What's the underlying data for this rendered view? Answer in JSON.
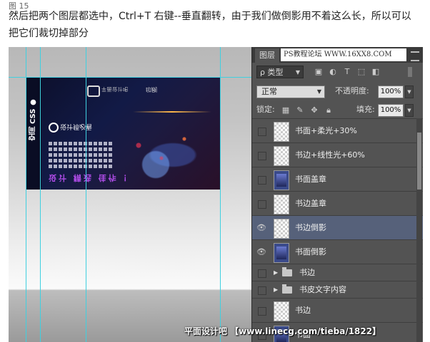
{
  "figure_label": "图 15",
  "caption": {
    "line1": "然后把两个图层都选中，Ctrl+T 右键--垂直翻转，由于我们做倒影用不着这么长，所以可以",
    "line2": "把它们裁切掉部分"
  },
  "book": {
    "spine_text": "空间 CSS ●",
    "brand": "平面设计吧",
    "brand2": "印刷",
    "title": "设计师必看",
    "purple_text": "设计 精选 佳作 ！"
  },
  "panel": {
    "tab_label": "图层",
    "watermark_text": "PS教程论坛 WWW.16XX8.COM",
    "filter": {
      "label": "ρ 类型",
      "icons": [
        "image-filter-icon",
        "adjustment-filter-icon",
        "type-filter-icon",
        "shape-filter-icon",
        "smart-object-filter-icon"
      ]
    },
    "blend_mode": "正常",
    "opacity_label": "不透明度:",
    "opacity_value": "100%",
    "lock_label": "锁定:",
    "fill_label": "填充:",
    "fill_value": "100%"
  },
  "layers": [
    {
      "name": "书面+柔光+30%",
      "visible": false,
      "thumb": "transparent",
      "selected": false
    },
    {
      "name": "书边+线性光+60%",
      "visible": false,
      "thumb": "transparent",
      "selected": false
    },
    {
      "name": "书面盖章",
      "visible": false,
      "thumb": "image",
      "selected": false
    },
    {
      "name": "书边盖章",
      "visible": false,
      "thumb": "transparent",
      "selected": false
    },
    {
      "name": "书边倒影",
      "visible": true,
      "thumb": "transparent",
      "selected": true
    },
    {
      "name": "书面倒影",
      "visible": true,
      "thumb": "image",
      "selected": false
    },
    {
      "name": "书边",
      "visible": false,
      "type": "group"
    },
    {
      "name": "书皮文字内容",
      "visible": false,
      "type": "group"
    },
    {
      "name": "书边",
      "visible": false,
      "thumb": "transparent",
      "selected": false
    },
    {
      "name": "书面",
      "visible": false,
      "thumb": "image",
      "selected": false
    }
  ],
  "bottom_watermark": "平面设计吧 【www.linecg.com/tieba/1822】",
  "colors": {
    "panel_bg": "#535353",
    "selected_row": "#56617a",
    "guide": "#3fd0e0"
  }
}
